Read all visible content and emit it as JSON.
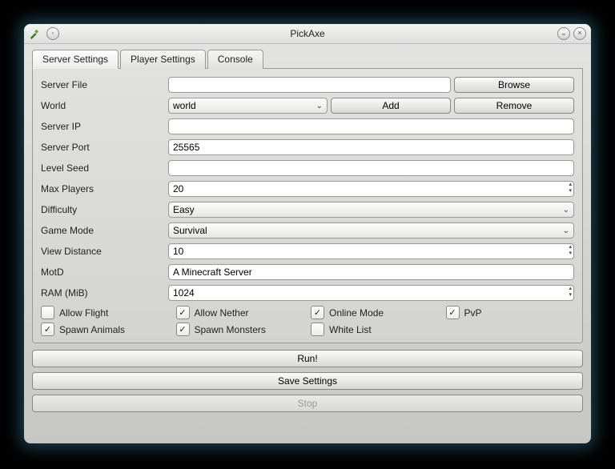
{
  "window": {
    "title": "PickAxe"
  },
  "tabs": [
    {
      "label": "Server Settings",
      "active": true
    },
    {
      "label": "Player Settings",
      "active": false
    },
    {
      "label": "Console",
      "active": false
    }
  ],
  "form": {
    "server_file": {
      "label": "Server File",
      "value": "",
      "browse": "Browse"
    },
    "world": {
      "label": "World",
      "value": "world",
      "add": "Add",
      "remove": "Remove"
    },
    "server_ip": {
      "label": "Server IP",
      "value": ""
    },
    "server_port": {
      "label": "Server Port",
      "value": "25565"
    },
    "level_seed": {
      "label": "Level Seed",
      "value": ""
    },
    "max_players": {
      "label": "Max Players",
      "value": "20"
    },
    "difficulty": {
      "label": "Difficulty",
      "value": "Easy"
    },
    "game_mode": {
      "label": "Game Mode",
      "value": "Survival"
    },
    "view_distance": {
      "label": "View Distance",
      "value": "10"
    },
    "motd": {
      "label": "MotD",
      "value": "A Minecraft Server"
    },
    "ram": {
      "label": "RAM (MiB)",
      "value": "1024"
    }
  },
  "checks": {
    "allow_flight": {
      "label": "Allow Flight",
      "checked": false
    },
    "allow_nether": {
      "label": "Allow Nether",
      "checked": true
    },
    "online_mode": {
      "label": "Online Mode",
      "checked": true
    },
    "pvp": {
      "label": "PvP",
      "checked": true
    },
    "spawn_animals": {
      "label": "Spawn Animals",
      "checked": true
    },
    "spawn_monsters": {
      "label": "Spawn Monsters",
      "checked": true
    },
    "white_list": {
      "label": "White List",
      "checked": false
    }
  },
  "buttons": {
    "run": "Run!",
    "save": "Save Settings",
    "stop": "Stop"
  }
}
